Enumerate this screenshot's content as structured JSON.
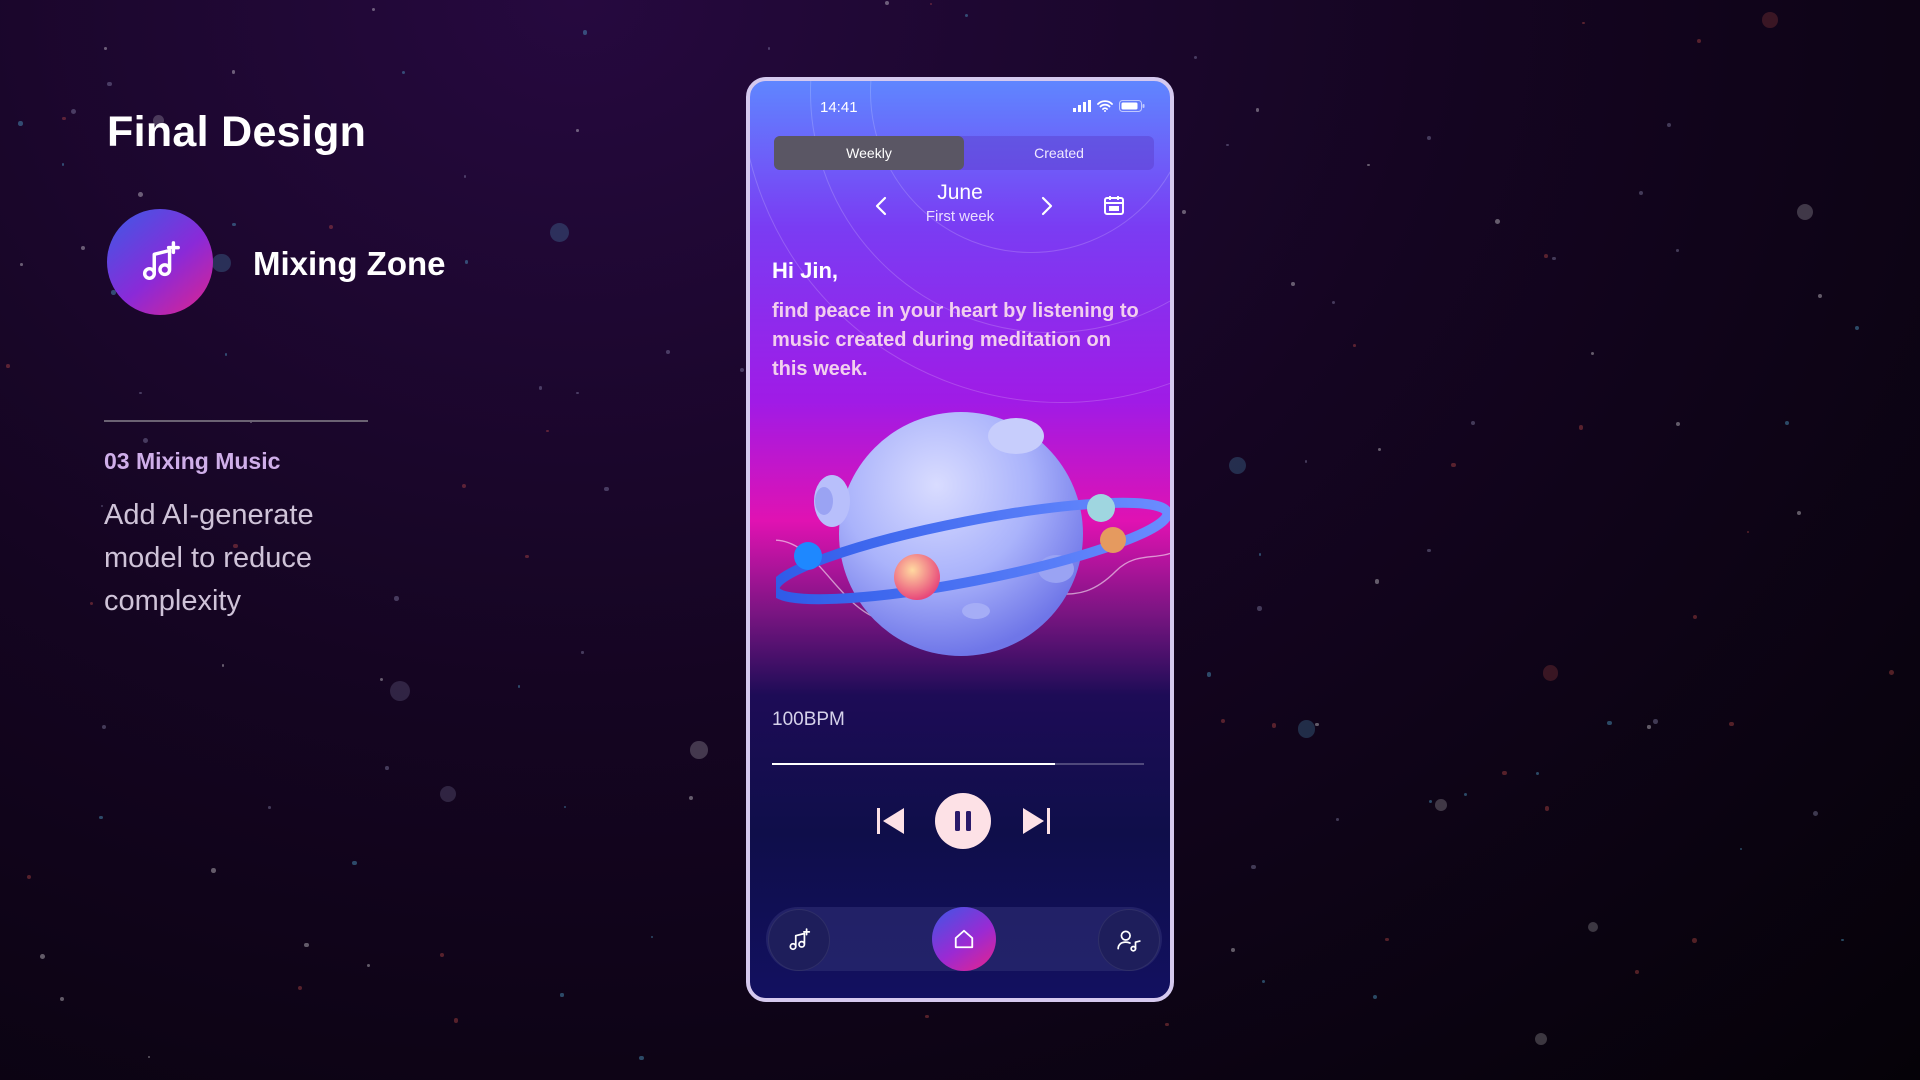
{
  "left_panel": {
    "title": "Final Design",
    "feature": {
      "label": "Mixing Zone",
      "icon": "music-note-plus-icon"
    },
    "section_title": "03 Mixing Music",
    "section_desc": "Add AI-generate model to reduce complexity"
  },
  "phone": {
    "status": {
      "time": "14:41",
      "icons": [
        "signal-icon",
        "wifi-icon",
        "battery-icon"
      ]
    },
    "tabs": [
      {
        "label": "Weekly",
        "active": true
      },
      {
        "label": "Created",
        "active": false
      }
    ],
    "period": {
      "month": "June",
      "week": "First week"
    },
    "greeting": "Hi Jin,",
    "message": "find peace in your heart by listening to music created during meditation on this week.",
    "player": {
      "bpm": "100BPM",
      "progress": 0.76,
      "state": "playing"
    },
    "nav": [
      "music-add-icon",
      "home-icon",
      "user-music-icon"
    ]
  },
  "colors": {
    "accent_start": "#3d57e6",
    "accent_mid": "#9a2ad3",
    "accent_end": "#e8238a",
    "section_title": "#cfaee9"
  }
}
